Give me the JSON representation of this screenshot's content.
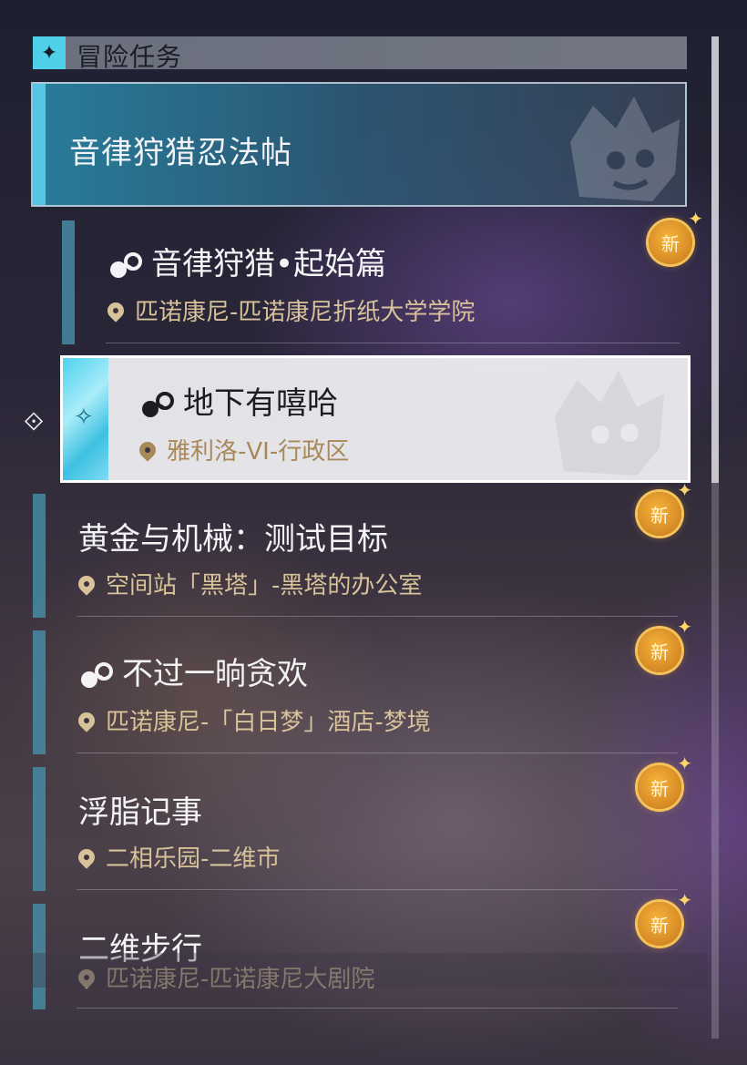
{
  "header": {
    "title": "冒险任务",
    "icon": "diamond-star-icon"
  },
  "category": {
    "title": "音律狩猎忍法帖"
  },
  "quests": [
    {
      "title": "音律狩猎•起始篇",
      "location": "匹诺康尼-匹诺康尼折纸大学学院",
      "badge": "新",
      "icon": "quest-type-icon"
    },
    {
      "title": "地下有嘻哈",
      "location": "雅利洛-VI-行政区",
      "icon": "quest-type-icon"
    },
    {
      "title": "黄金与机械：测试目标",
      "location": "空间站「黑塔」-黑塔的办公室",
      "badge": "新"
    },
    {
      "title": "不过一晌贪欢",
      "location": "匹诺康尼-「白日梦」酒店-梦境",
      "badge": "新",
      "icon": "quest-type-icon"
    },
    {
      "title": "浮脂记事",
      "location": "二相乐园-二维市",
      "badge": "新"
    },
    {
      "title": "二维步行",
      "location": "匹诺康尼-匹诺康尼大剧院",
      "badge": "新"
    }
  ],
  "colors": {
    "accent": "#56c6e6",
    "badge": "#e89a2a",
    "location": "#d8c29a"
  }
}
